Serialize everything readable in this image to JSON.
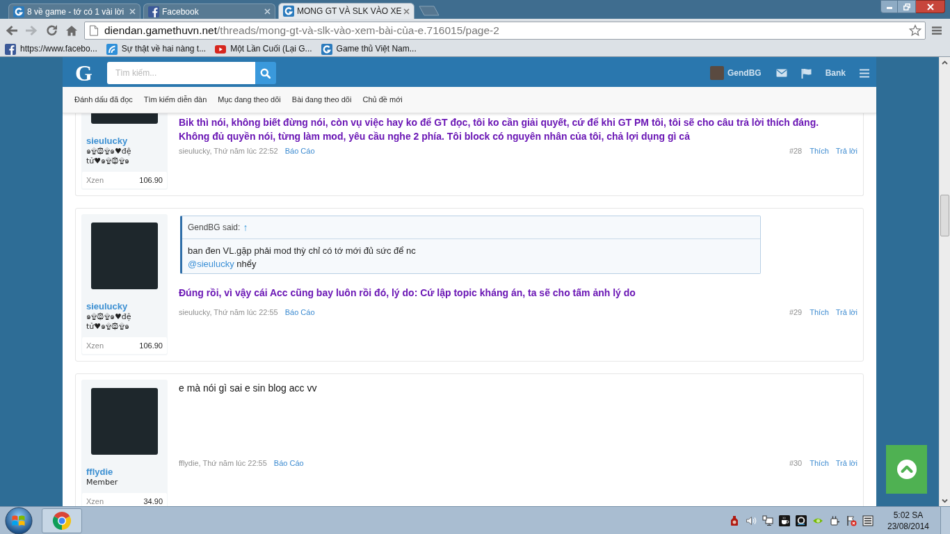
{
  "browser": {
    "tabs": [
      {
        "title": "8 về game - tớ có 1 vài lời",
        "kind": "forum",
        "selected": false
      },
      {
        "title": "Facebook",
        "kind": "facebook",
        "selected": false
      },
      {
        "title": "MONG GT VÀ SLK VÀO XE",
        "kind": "forum",
        "selected": true
      }
    ],
    "address_bar": {
      "host": "diendan.gamethuvn.net",
      "path": "/threads/mong-gt-và-slk-vào-xem-bài-của-e.716015/page-2"
    },
    "bookmarks": [
      {
        "label": "https://www.facebo...",
        "kind": "facebook"
      },
      {
        "label": "Sự thật về hai nàng t...",
        "kind": "feed"
      },
      {
        "label": "Một Lần Cuối (Lại G...",
        "kind": "video"
      },
      {
        "label": "Game thủ Việt Nam...",
        "kind": "forum"
      }
    ]
  },
  "forum": {
    "header": {
      "logo": "G",
      "search": {
        "placeholder": "Tìm kiếm..."
      },
      "username": "GendBG",
      "bank": "Bank"
    },
    "nav": [
      "Đánh dấu đã đọc",
      "Tìm kiếm diễn đàn",
      "Mục đang theo dõi",
      "Bài đang theo dõi",
      "Chủ đề mới"
    ],
    "posts": [
      {
        "author": "sieulucky",
        "user_title": "๑۩۞۩๑♥đệ tử♥๑۩۞۩๑",
        "stat_label": "Xzen",
        "stat_value": "106.90",
        "message": {
          "kind": "emphasized",
          "lines": [
            "Bik thì nói, không biết đừng nói, còn vụ việc hay ko để GT đọc, tôi ko cần giải quyết, cứ để khi GT PM tôi, tôi sẽ cho câu trả lời thích đáng.",
            "Không đủ quyền nói, từng làm mod, yêu cầu nghe 2 phía. Tôi block có nguyên nhân của tôi, chả lợi dụng gì cả"
          ]
        },
        "byline": "sieulucky, Thứ năm lúc 22:52",
        "report": "Báo Cáo",
        "number": "#28",
        "like": "Thích",
        "reply": "Trả lời"
      },
      {
        "author": "sieulucky",
        "user_title": "๑۩۞۩๑♥đệ tử♥๑۩۞۩๑",
        "stat_label": "Xzen",
        "stat_value": "106.90",
        "quote": {
          "attribution": "GendBG said:",
          "jump": "↑",
          "lines": [
            [
              {
                "kind": "text",
                "text": "ban đen VL.gặp phải mod thỳ chỉ có tớ mới đủ sức để nc"
              }
            ],
            [
              {
                "kind": "mention",
                "text": "@sieulucky"
              },
              {
                "kind": "text",
                "text": "nhểy"
              }
            ]
          ]
        },
        "message": {
          "kind": "emphasized",
          "lines": [
            "Đúng rồi, vì vậy cái Acc cũng bay luôn rồi đó, lý do: Cứ lập topic kháng án, ta sẽ cho tấm ảnh lý do"
          ]
        },
        "byline": "sieulucky, Thứ năm lúc 22:55",
        "report": "Báo Cáo",
        "number": "#29",
        "like": "Thích",
        "reply": "Trả lời"
      },
      {
        "author": "fflydie",
        "user_title": "Member",
        "stat_label": "Xzen",
        "stat_value": "34.90",
        "message": {
          "kind": "plain",
          "lines": [
            "e mà nói gì sai e sin blog acc vv"
          ]
        },
        "byline": "fflydie, Thứ năm lúc 22:55",
        "report": "Báo Cáo",
        "number": "#30",
        "like": "Thích",
        "reply": "Trả lời"
      }
    ]
  },
  "taskbar": {
    "time": "5:02 SA",
    "date": "23/08/2014"
  }
}
